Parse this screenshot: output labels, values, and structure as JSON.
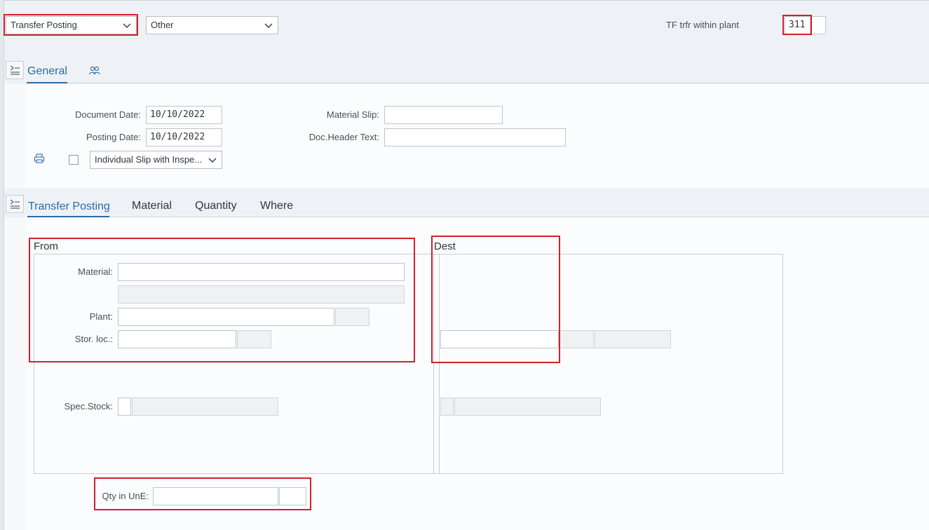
{
  "toolbar": {
    "action_select": "Transfer Posting",
    "reference_select": "Other",
    "movement_type_label": "TF trfr within plant",
    "movement_type_value": "311",
    "movement_type_ind": ""
  },
  "general": {
    "tab_label": "General",
    "document_date_label": "Document Date:",
    "document_date_value": "10/10/2022",
    "posting_date_label": "Posting Date:",
    "posting_date_value": "10/10/2022",
    "material_slip_label": "Material Slip:",
    "material_slip_value": "",
    "doc_header_label": "Doc.Header Text:",
    "doc_header_value": "",
    "slip_type_select": "Individual Slip with Inspe..."
  },
  "detail_tabs": [
    "Transfer Posting",
    "Material",
    "Quantity",
    "Where"
  ],
  "from": {
    "title": "From",
    "material_label": "Material:",
    "plant_label": "Plant:",
    "stor_loc_label": "Stor. loc.:",
    "spec_stock_label": "Spec.Stock:"
  },
  "dest": {
    "title": "Dest"
  },
  "quantity": {
    "label": "Qty in UnE:",
    "value": "",
    "unit": ""
  },
  "colors": {
    "highlight": "#d3202d",
    "active_tab": "#2b6aa6"
  }
}
